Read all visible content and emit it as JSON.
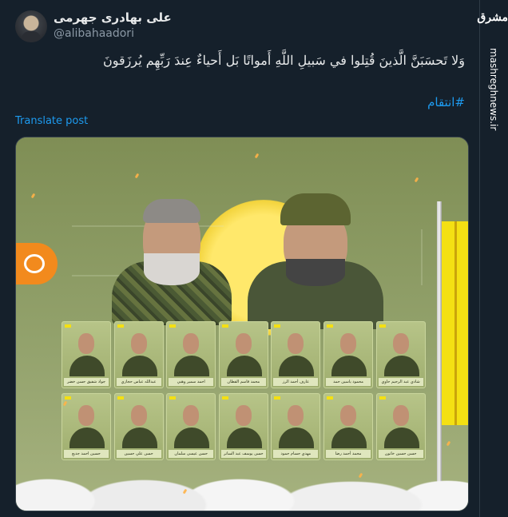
{
  "post": {
    "author_name": "علی بهادری جهرمی",
    "author_handle": "@alibahaadori",
    "text": "وَلا تَحسَبَنَّ الَّذينَ قُتِلوا في سَبيلِ اللَّهِ أَمواتًا بَل أَحياءٌ عِندَ رَبِّهِم يُرزَقونَ",
    "hashtag": "#انتقام",
    "translate_label": "Translate post"
  },
  "media": {
    "description_icon": "martyrs-poster",
    "cards": [
      {
        "label": "جواد شفيق حسن خضر"
      },
      {
        "label": "عبدالله عباس حجازي"
      },
      {
        "label": "احمد سمير وهبي"
      },
      {
        "label": "محمد قاسم القطان"
      },
      {
        "label": "عارف أحمد الرز"
      },
      {
        "label": "محمود ياسين حمد"
      },
      {
        "label": "شادي عبد الرحيم حاوي"
      },
      {
        "label": "حسين احمد جديع"
      },
      {
        "label": "حسن علي حسين"
      },
      {
        "label": "حسن عيسى سلمان"
      },
      {
        "label": "حسن يوسف عبد الساتر"
      },
      {
        "label": "مهدي حسام حمود"
      },
      {
        "label": "محمد أحمد رضا"
      },
      {
        "label": "حسن حسين خاتون"
      }
    ]
  },
  "sidebar": {
    "logo": "مشرق",
    "site": "mashreghnews.ir"
  },
  "colors": {
    "background": "#15202b",
    "link": "#1d9bf0",
    "muted": "#8b98a5",
    "flag_yellow": "#f4e013"
  }
}
